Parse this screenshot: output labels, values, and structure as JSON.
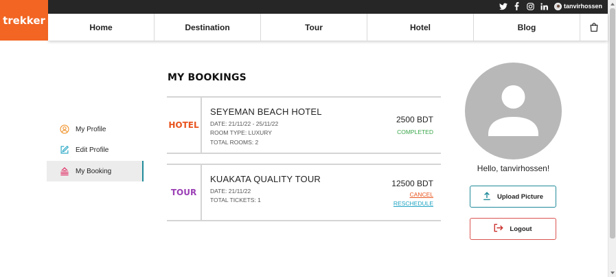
{
  "brand": {
    "logo_text": "trekker",
    "accent": "#f26522"
  },
  "topbar": {
    "social_icons": [
      "twitter-icon",
      "facebook-icon",
      "instagram-icon",
      "linkedin-icon"
    ],
    "username": "tanvirhossen"
  },
  "nav": {
    "items": [
      "Home",
      "Destination",
      "Tour",
      "Hotel",
      "Blog"
    ],
    "cart_icon": "shopping-bag-icon"
  },
  "sidebar": {
    "items": [
      {
        "label": "My Profile",
        "icon": "user-circle-icon"
      },
      {
        "label": "Edit Profile",
        "icon": "edit-icon"
      },
      {
        "label": "My Booking",
        "icon": "booking-stack-icon"
      }
    ],
    "active": "My Booking"
  },
  "bookings": {
    "heading": "MY BOOKINGS",
    "items": [
      {
        "type": "HOTEL",
        "type_color": "#e8541e",
        "title": "SEYEMAN BEACH HOTEL",
        "date": "DATE: 21/11/22 - 25/11/22",
        "detail1": "ROOM TYPE: LUXURY",
        "detail2": "TOTAL ROOMS: 2",
        "price": "2500 BDT",
        "status": "COMPLETED",
        "status_color": "#3aa64a"
      },
      {
        "type": "TOUR",
        "type_color": "#9b3fb5",
        "title": "KUAKATA QUALITY TOUR",
        "date": "DATE: 21/11/22",
        "detail1": "TOTAL TICKETS: 1",
        "price": "12500 BDT",
        "cancel": "CANCEL",
        "cancel_color": "#e8541e",
        "reschedule": "RESCHEDULE",
        "reschedule_color": "#1fa3c2"
      }
    ]
  },
  "profile": {
    "greeting": "Hello, tanvirhossen!",
    "upload_label": "Upload Picture",
    "logout_label": "Logout"
  }
}
